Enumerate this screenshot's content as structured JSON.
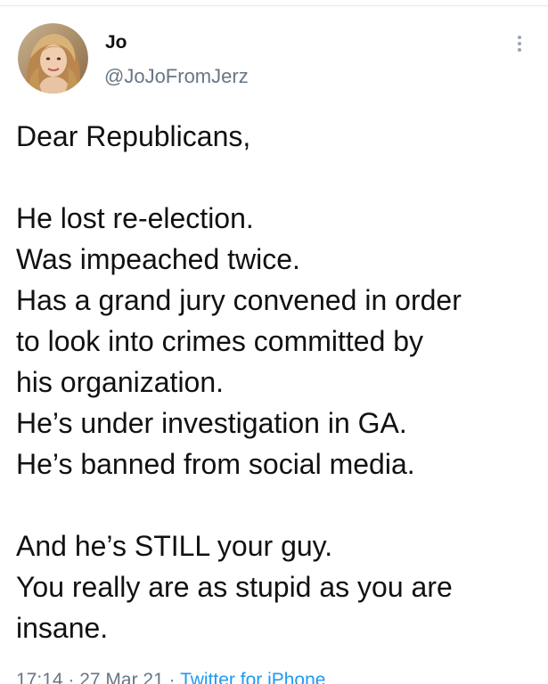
{
  "user": {
    "display_name": "Jo",
    "handle": "@JoJoFromJerz"
  },
  "tweet": {
    "greeting": "Dear Republicans,",
    "lines": [
      "He lost re-election.",
      "Was impeached twice.",
      "Has a grand jury convened in order",
      "to look into crimes committed by",
      "his organization.",
      "He’s under investigation in GA.",
      "He’s banned from social media."
    ],
    "closing": [
      "And he’s STILL your guy.",
      "You really are as stupid as you are",
      "insane."
    ]
  },
  "meta": {
    "timestamp": "17:14 · 27 Mar 21 ·",
    "source": "Twitter for iPhone"
  },
  "colors": {
    "text": "#111111",
    "secondary": "#687684",
    "link": "#1d9bf0"
  },
  "icons": {
    "more": "vertical-ellipsis"
  }
}
